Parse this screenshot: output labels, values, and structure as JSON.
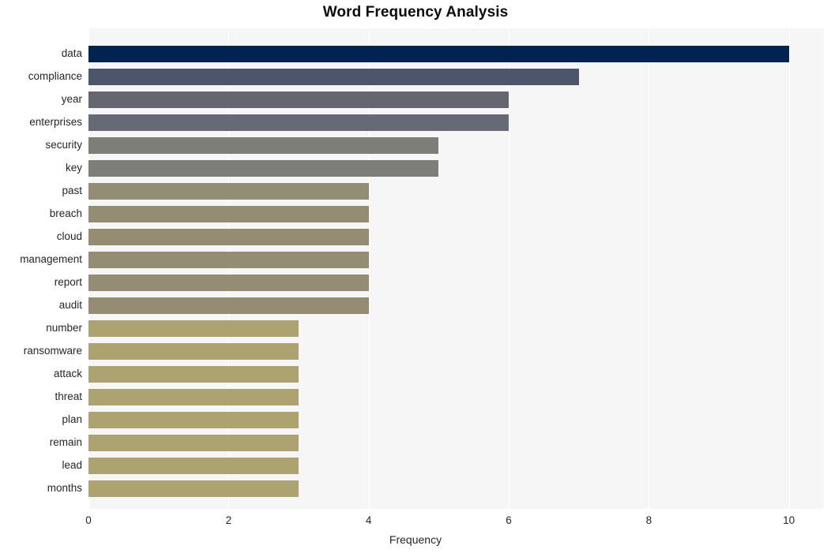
{
  "chart_data": {
    "type": "bar",
    "orientation": "horizontal",
    "title": "Word Frequency Analysis",
    "xlabel": "Frequency",
    "ylabel": "",
    "categories": [
      "data",
      "compliance",
      "year",
      "enterprises",
      "security",
      "key",
      "past",
      "breach",
      "cloud",
      "management",
      "report",
      "audit",
      "number",
      "ransomware",
      "attack",
      "threat",
      "plan",
      "remain",
      "lead",
      "months"
    ],
    "values": [
      10,
      7,
      6,
      6,
      5,
      5,
      4,
      4,
      4,
      4,
      4,
      4,
      3,
      3,
      3,
      3,
      3,
      3,
      3,
      3
    ],
    "bar_colors": [
      "#00234f",
      "#4d556d",
      "#64676f",
      "#676a75",
      "#7d7d7a",
      "#7d7d7a",
      "#948d75",
      "#948d74",
      "#948d74",
      "#948d74",
      "#948d74",
      "#948d74",
      "#ada371",
      "#ada371",
      "#ada371",
      "#ada371",
      "#ada371",
      "#ada371",
      "#ada371",
      "#ada371"
    ],
    "xticks": [
      0,
      2,
      4,
      6,
      8,
      10
    ],
    "xtick_labels": [
      "0",
      "2",
      "4",
      "6",
      "8",
      "10"
    ],
    "xlim": [
      0,
      10.5
    ],
    "grid": true,
    "grid_color": "#ffffff",
    "plot_background": "#f6f6f7",
    "figure_background": "#ffffff",
    "legend": null
  }
}
